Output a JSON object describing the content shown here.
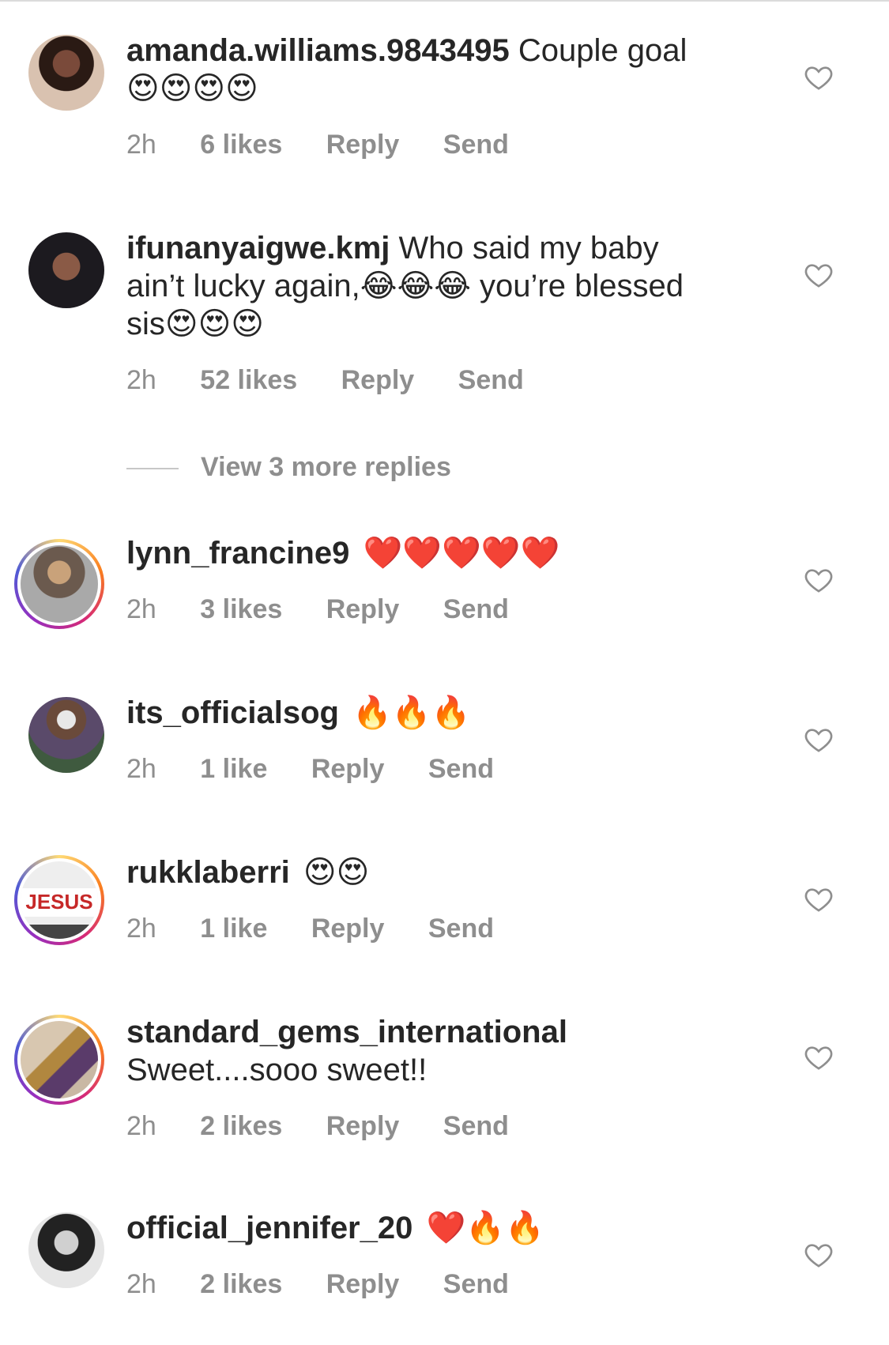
{
  "comments": [
    {
      "username": "amanda.williams.9843495",
      "text": "Couple goal",
      "emojis": "😍😍😍😍",
      "time": "2h",
      "likes": "6 likes",
      "reply": "Reply",
      "send": "Send"
    },
    {
      "username": "ifunanyaigwe.kmj",
      "text": "Who said my baby ain’t lucky again,😂😂😂 you’re blessed sis😍😍😍",
      "time": "2h",
      "likes": "52 likes",
      "reply": "Reply",
      "send": "Send"
    },
    {
      "username": "lynn_francine9",
      "emojis": "❤️❤️❤️❤️❤️",
      "time": "2h",
      "likes": "3 likes",
      "reply": "Reply",
      "send": "Send"
    },
    {
      "username": "its_officialsog",
      "emojis": "🔥🔥🔥",
      "time": "2h",
      "likes": "1 like",
      "reply": "Reply",
      "send": "Send"
    },
    {
      "username": "rukklaberri",
      "emojis": "😍😍",
      "time": "2h",
      "likes": "1 like",
      "reply": "Reply",
      "send": "Send",
      "avatar_text": "JESUS"
    },
    {
      "username": "standard_gems_international",
      "text": "Sweet....sooo sweet!!",
      "time": "2h",
      "likes": "2 likes",
      "reply": "Reply",
      "send": "Send"
    },
    {
      "username": "official_jennifer_20",
      "emojis": "❤️🔥🔥",
      "time": "2h",
      "likes": "2 likes",
      "reply": "Reply",
      "send": "Send"
    }
  ],
  "view_more": "View 3 more replies",
  "colors": {
    "text": "#262626",
    "secondary": "#8e8e8e",
    "story_ring": "#d62976"
  },
  "icons": {
    "like": "heart-outline-icon"
  }
}
